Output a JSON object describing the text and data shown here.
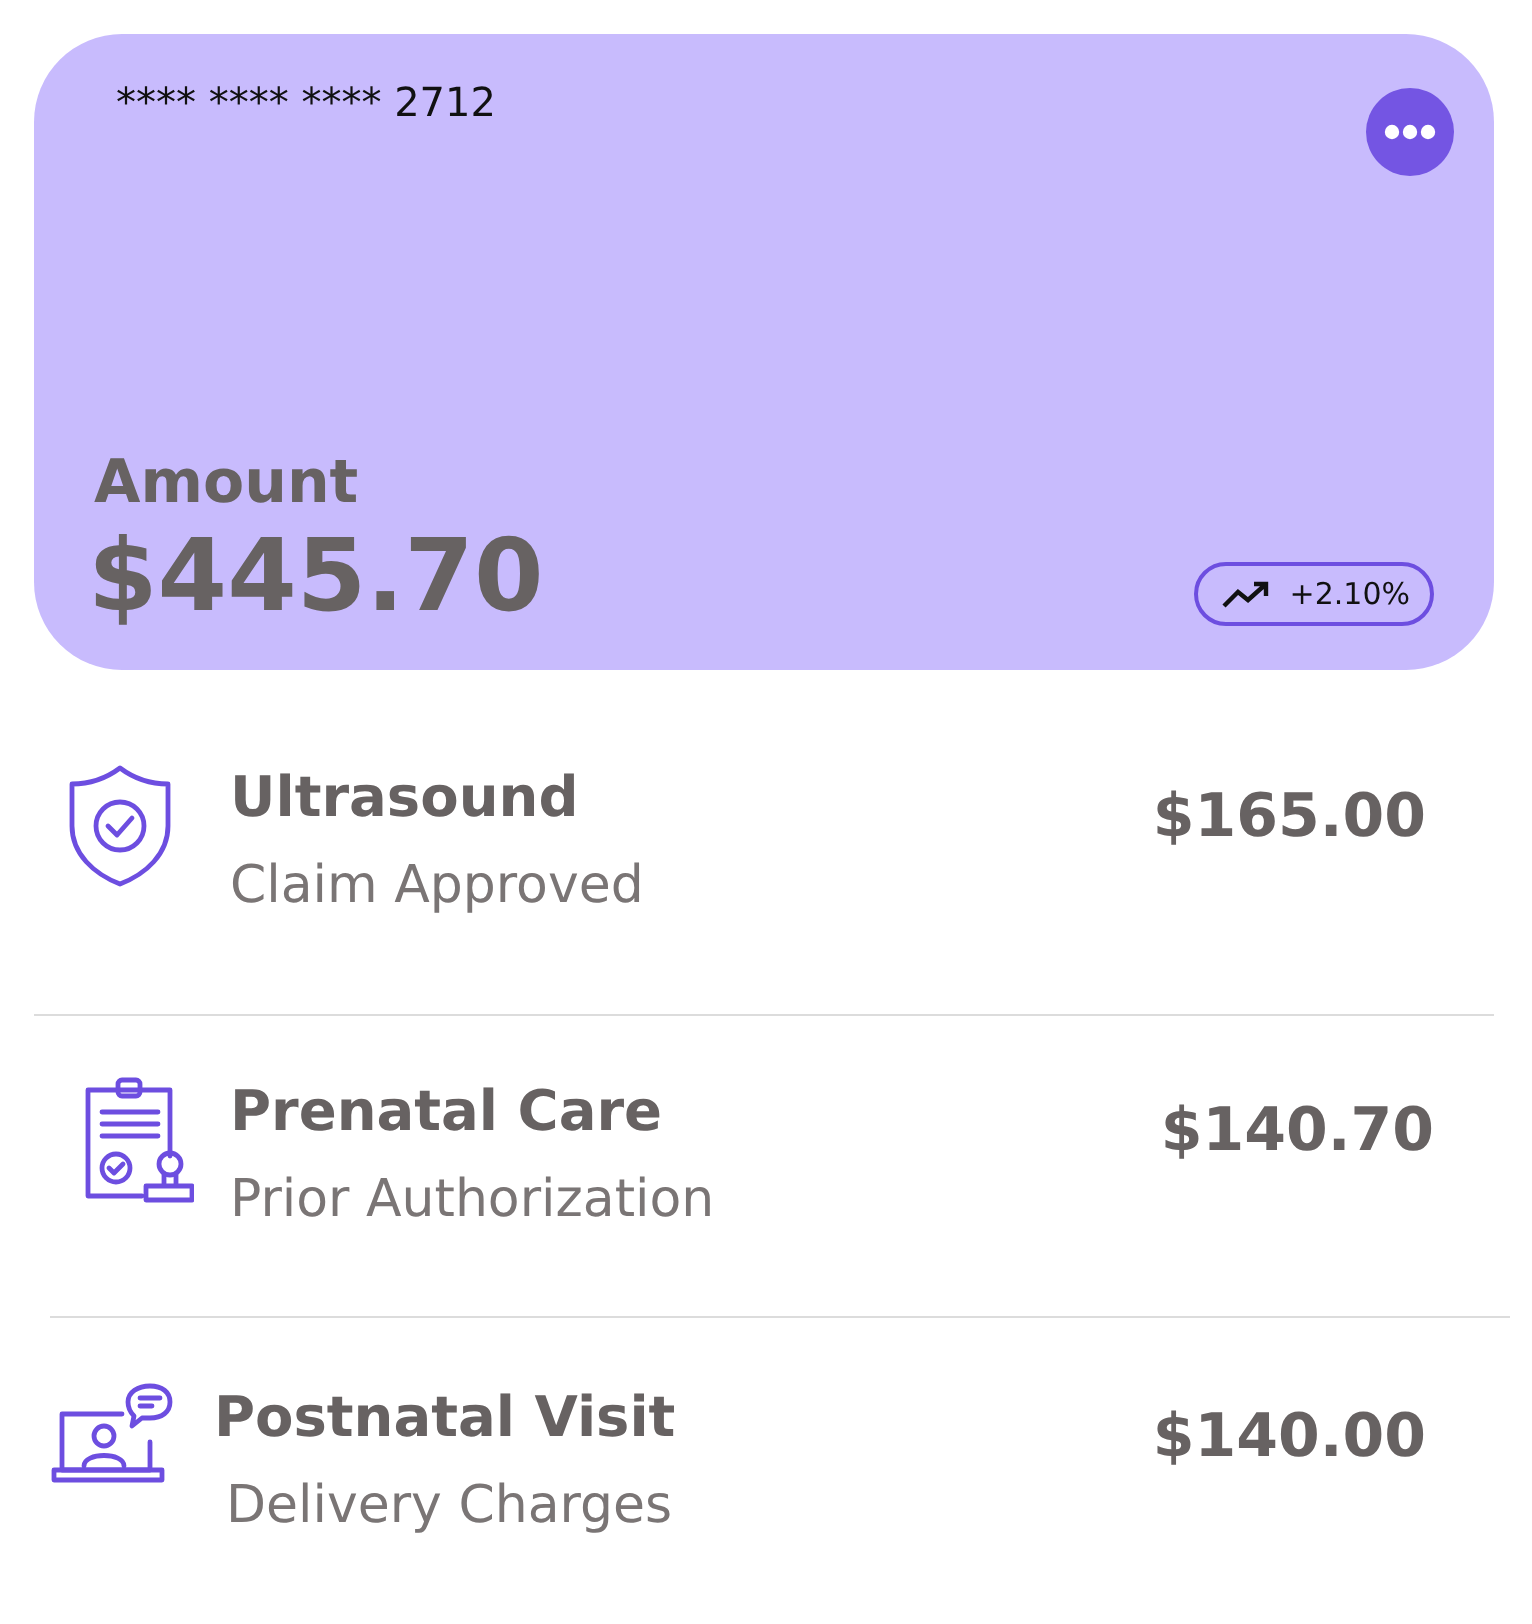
{
  "card": {
    "number": "**** **** **** 2712",
    "label": "Amount",
    "amount": "$445.70",
    "change": "+2.10%"
  },
  "items": [
    {
      "kind": "shield",
      "title": "Ultrasound",
      "subtitle": "Claim Approved",
      "amount": "$165.00"
    },
    {
      "kind": "clipboard",
      "title": "Prenatal Care",
      "subtitle": "Prior Authorization",
      "amount": "$140.70"
    },
    {
      "kind": "laptop",
      "title": "Postnatal Visit",
      "subtitle": "Delivery Charges",
      "amount": "$140.00"
    }
  ]
}
